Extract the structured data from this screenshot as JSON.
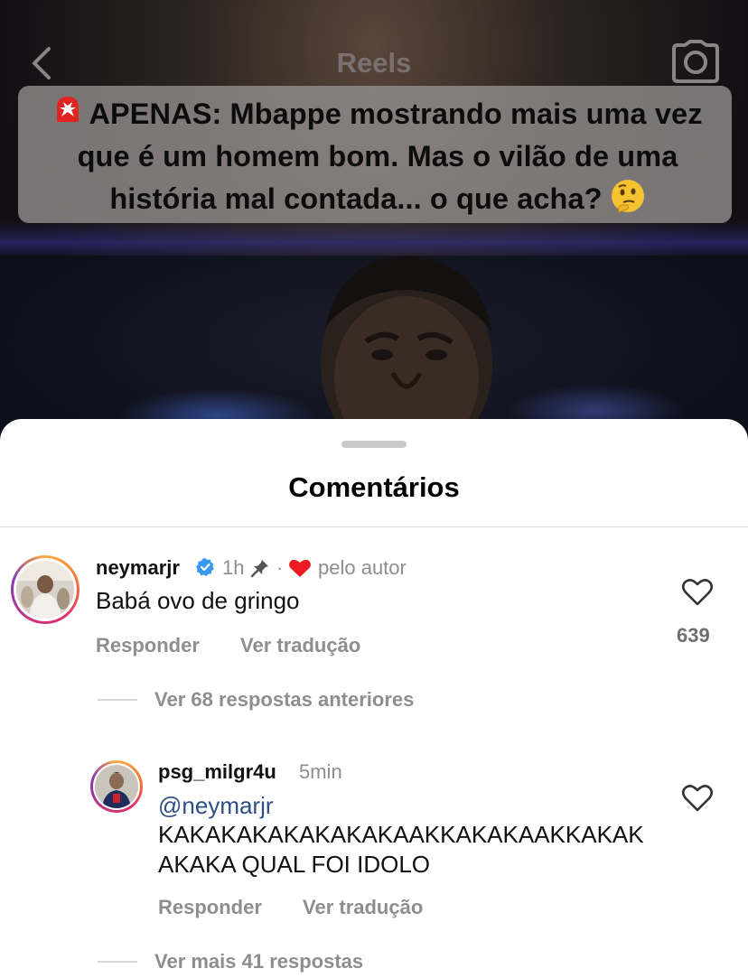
{
  "header": {
    "title": "Reels"
  },
  "caption": {
    "text": "APENAS: Mbappe mostrando mais uma vez que é um homem bom. Mas o vilão de uma história mal contada... o que acha?"
  },
  "comments_sheet": {
    "title": "Comentários",
    "comments": [
      {
        "username": "neymarjr",
        "verified": true,
        "time": "1h",
        "pinned": true,
        "liked_by_author_label": "pelo autor",
        "text": "Babá ovo de gringo",
        "reply_label": "Responder",
        "translate_label": "Ver tradução",
        "like_count": "639",
        "view_replies_label": "Ver 68 respostas anteriores"
      }
    ],
    "reply": {
      "username": "psg_milgr4u",
      "time": "5min",
      "mention": "@neymarjr",
      "text_line1": "KAKAKAKAKAKAKAKAAKKAKAKAAKKAKAK",
      "text_line2": "AKAKA QUAL FOI IDOLO",
      "reply_label": "Responder",
      "translate_label": "Ver tradução"
    },
    "more_replies_label": "Ver mais 41 respostas"
  },
  "colors": {
    "verified_badge": "#3897f0",
    "heart_red": "#ed1c24",
    "mention": "#2d4f86"
  }
}
